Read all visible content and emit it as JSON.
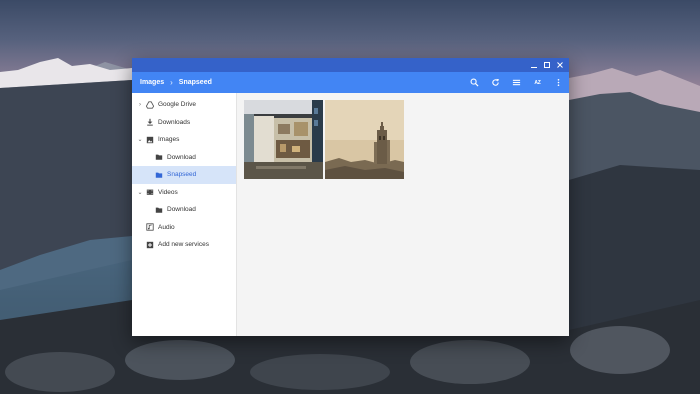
{
  "window": {
    "frame_controls": [
      "minimize-icon",
      "maximize-icon",
      "close-icon"
    ],
    "accent_color": "#4285f4",
    "frame_color": "#3562c9"
  },
  "breadcrumb": {
    "items": [
      "Images",
      "Snapseed"
    ],
    "separator": "›"
  },
  "toolbar": {
    "buttons": [
      "search-icon",
      "refresh-icon",
      "view-icon",
      "sort-icon",
      "more-icon"
    ],
    "sort_label": "AZ"
  },
  "sidebar": {
    "items": [
      {
        "label": "Google Drive",
        "icon": "drive-icon",
        "arrow": "›"
      },
      {
        "label": "Downloads",
        "icon": "download-icon"
      },
      {
        "label": "Images",
        "icon": "image-icon",
        "arrow": "⌄"
      },
      {
        "label": "Download",
        "icon": "folder-icon"
      },
      {
        "label": "Snapseed",
        "icon": "folder-icon",
        "selected": true
      },
      {
        "label": "Videos",
        "icon": "video-icon",
        "arrow": "⌄"
      },
      {
        "label": "Download",
        "icon": "folder-icon"
      },
      {
        "label": "Audio",
        "icon": "audio-icon"
      },
      {
        "label": "Add new services",
        "icon": "add-icon"
      }
    ],
    "selected_color": "#3367d6"
  },
  "files": {
    "thumbnails": [
      "photo-room",
      "photo-tower"
    ]
  }
}
